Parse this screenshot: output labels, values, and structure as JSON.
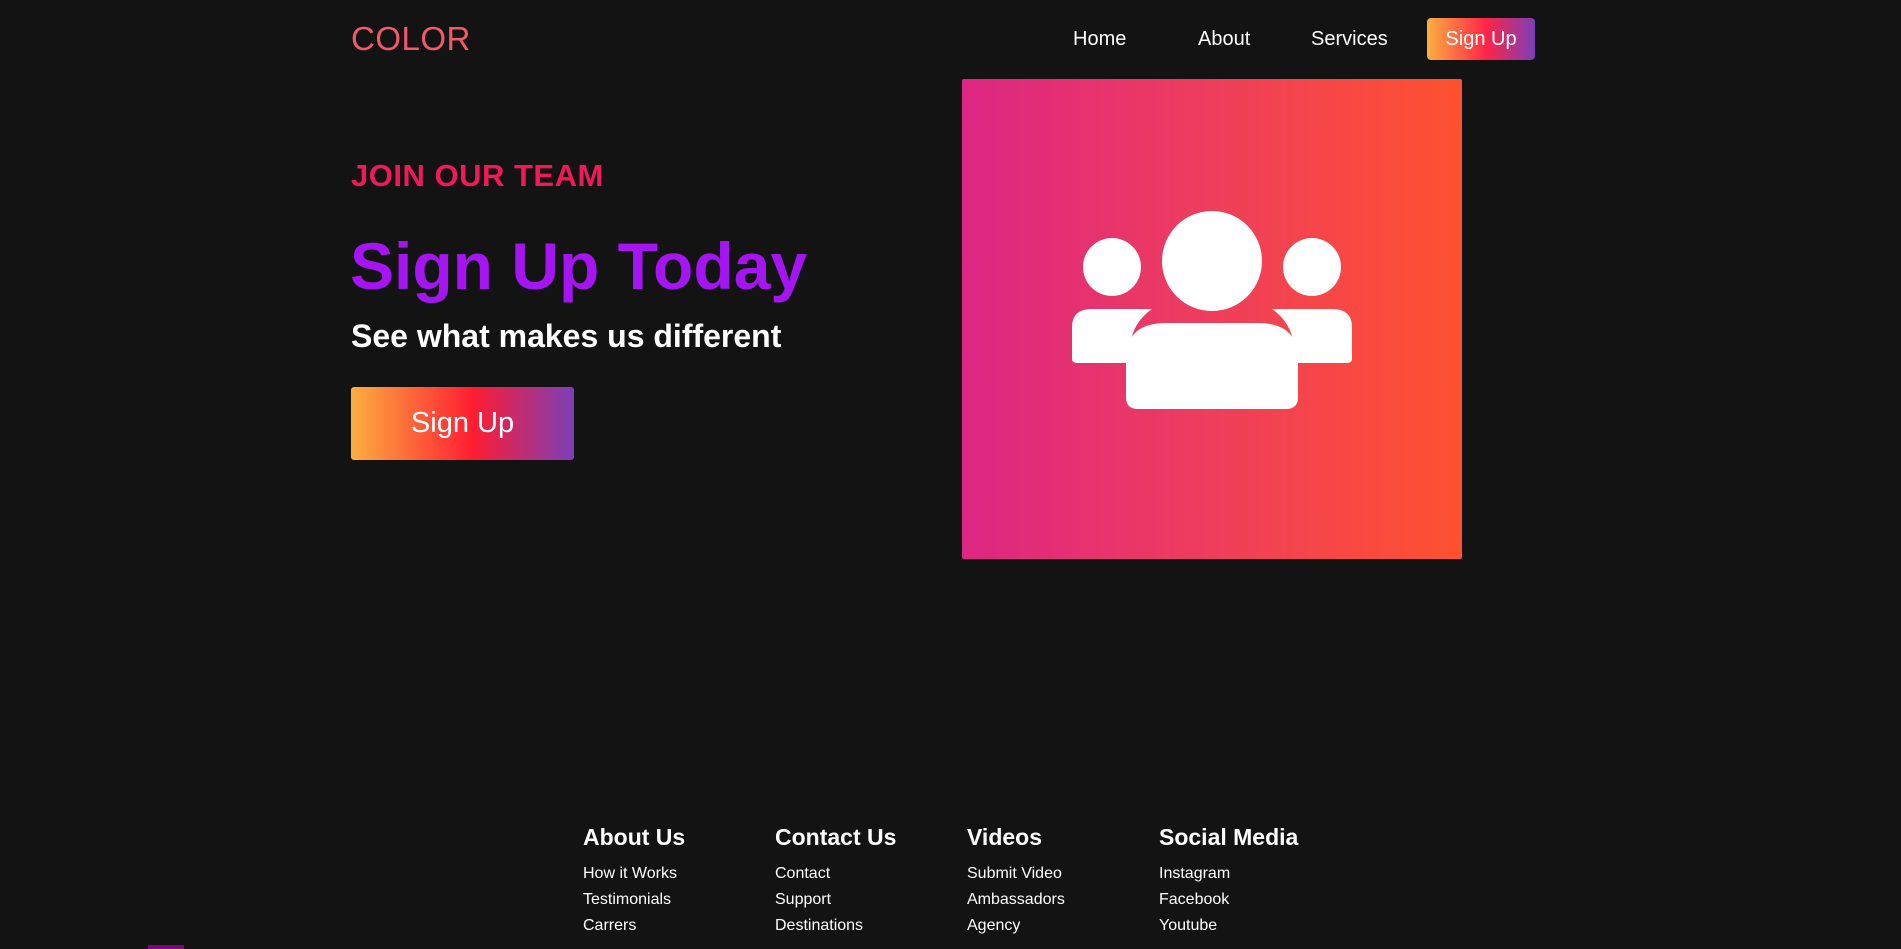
{
  "navbar": {
    "logo": "COLOR",
    "links": [
      {
        "label": "Home"
      },
      {
        "label": "About"
      },
      {
        "label": "Services"
      }
    ],
    "signup_label": "Sign Up"
  },
  "hero": {
    "eyebrow": "JOIN OUR TEAM",
    "title": "Sign Up Today",
    "subtitle": "See what makes us different",
    "signup_label": "Sign Up",
    "image_icon": "users-group-icon"
  },
  "footer": {
    "columns": [
      {
        "heading": "About Us",
        "links": [
          "How it Works",
          "Testimonials",
          "Carrers"
        ]
      },
      {
        "heading": "Contact Us",
        "links": [
          "Contact",
          "Support",
          "Destinations"
        ]
      },
      {
        "heading": "Videos",
        "links": [
          "Submit Video",
          "Ambassadors",
          "Agency"
        ]
      },
      {
        "heading": "Social Media",
        "links": [
          "Instagram",
          "Facebook",
          "Youtube"
        ]
      }
    ]
  },
  "colors": {
    "background": "#131313",
    "logo": "#f25a6a",
    "eyebrow": "#ef1a5a",
    "title": "#a515f2",
    "gradient_start": "#fdae41",
    "gradient_mid": "#fd1d32",
    "gradient_end": "#7b3fb8",
    "card_start": "#dd2683",
    "card_end": "#ff512f"
  }
}
